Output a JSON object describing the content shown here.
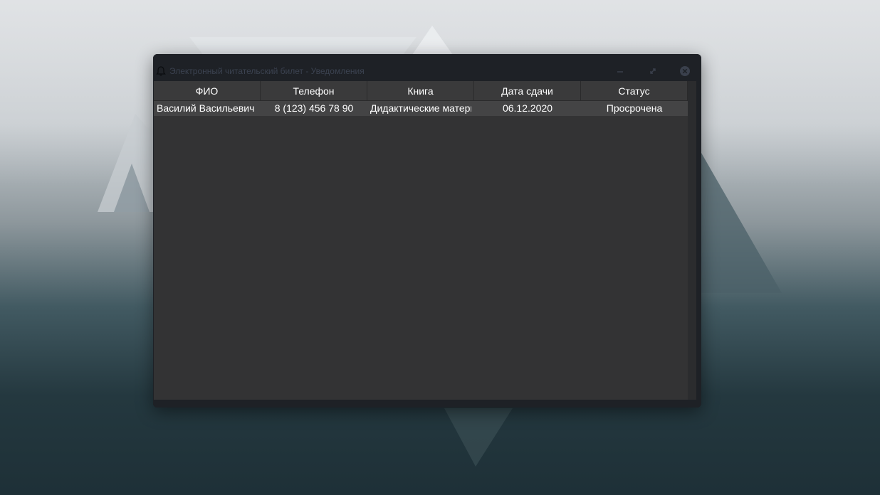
{
  "window": {
    "title": "Электронный читательский билет - Уведомления"
  },
  "icons": {
    "window_icon": "bell-icon",
    "minimize": "minimize-icon",
    "maximize": "maximize-icon",
    "close": "close-icon"
  },
  "table": {
    "columns": [
      "ФИО",
      "Телефон",
      "Книга",
      "Дата сдачи",
      "Статус"
    ],
    "rows": [
      {
        "name": "Василий Васильевич",
        "phone": "8 (123) 456 78 90",
        "book": "Дидактические материалы",
        "due_date": "06.12.2020",
        "status": "Просрочена"
      }
    ]
  },
  "colors": {
    "window_bg": "#1e2126",
    "table_bg": "#333334",
    "header_bg": "#3a3a3b",
    "row_bg": "#444445",
    "text": "#ffffff",
    "title_text": "#3b4250"
  }
}
